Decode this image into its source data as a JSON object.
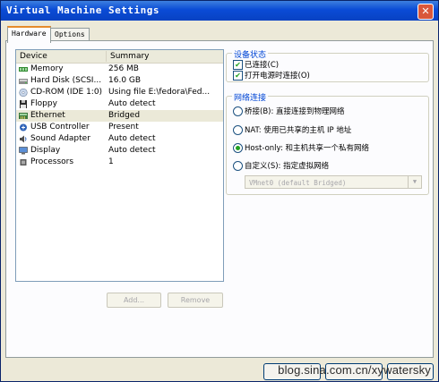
{
  "window": {
    "title": "Virtual Machine Settings",
    "close_glyph": "✕"
  },
  "tabs": [
    {
      "label": "Hardware",
      "active": true
    },
    {
      "label": "Options",
      "active": false
    }
  ],
  "device_list": {
    "columns": [
      "Device",
      "Summary"
    ],
    "rows": [
      {
        "device": "Memory",
        "summary": "256 MB",
        "icon": "memory-icon",
        "selected": false
      },
      {
        "device": "Hard Disk (SCSI...",
        "summary": "16.0 GB",
        "icon": "hard-disk-icon",
        "selected": false
      },
      {
        "device": "CD-ROM (IDE 1:0)",
        "summary": "Using file E:\\fedora\\Fed...",
        "icon": "cdrom-icon",
        "selected": false
      },
      {
        "device": "Floppy",
        "summary": "Auto detect",
        "icon": "floppy-icon",
        "selected": false
      },
      {
        "device": "Ethernet",
        "summary": "Bridged",
        "icon": "ethernet-icon",
        "selected": true
      },
      {
        "device": "USB Controller",
        "summary": "Present",
        "icon": "usb-icon",
        "selected": false
      },
      {
        "device": "Sound Adapter",
        "summary": "Auto detect",
        "icon": "sound-icon",
        "selected": false
      },
      {
        "device": "Display",
        "summary": "Auto detect",
        "icon": "display-icon",
        "selected": false
      },
      {
        "device": "Processors",
        "summary": "1",
        "icon": "processor-icon",
        "selected": false
      }
    ]
  },
  "buttons": {
    "add": "Add...",
    "remove": "Remove"
  },
  "device_status": {
    "title": "设备状态",
    "connected": {
      "label": "已连接(C)",
      "checked": true
    },
    "connect_at_power_on": {
      "label": "打开电源时连接(O)",
      "checked": true
    }
  },
  "network_connection": {
    "title": "网络连接",
    "options": [
      {
        "label": "桥接(B): 直接连接到物理网络",
        "selected": false
      },
      {
        "label": "NAT: 使用已共享的主机 IP 地址",
        "selected": false
      },
      {
        "label": "Host-only: 和主机共享一个私有网络",
        "selected": true
      },
      {
        "label": "自定义(S): 指定虚拟网络",
        "selected": false
      }
    ],
    "vmnet_select": "VMnet0 (default Bridged)"
  },
  "watermark": "blog.sina.com.cn/xywatersky",
  "colors": {
    "title_bar": "#0a4bd6",
    "group_title": "#0046d5",
    "check_green": "#21a121",
    "selected_row": "#ebe9d8"
  }
}
